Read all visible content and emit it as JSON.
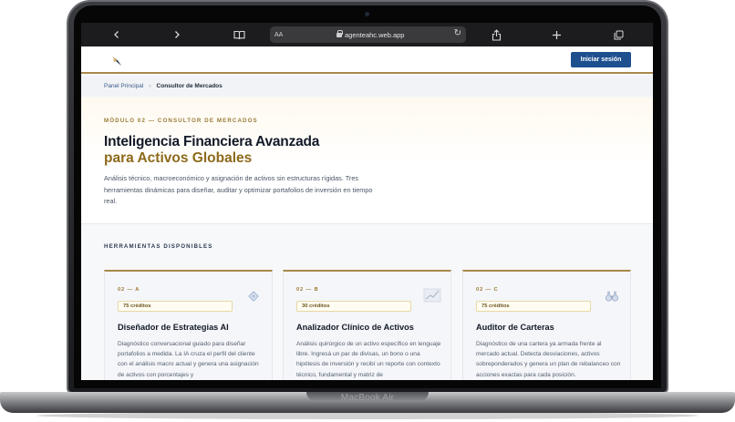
{
  "device": {
    "model_label": "MacBook Air"
  },
  "browser": {
    "address_text_size": "AA",
    "url": "agenteahc.web.app",
    "icons": [
      "back-icon",
      "forward-icon",
      "bookmarks-icon",
      "reload-icon",
      "share-icon",
      "new-tab-icon",
      "tabs-icon"
    ]
  },
  "header": {
    "login_label": "Iniciar sesión",
    "brand_color": "#1e4f8f",
    "accent_color": "#a8894a"
  },
  "breadcrumb": {
    "home": "Panel Principal",
    "separator": "›",
    "current": "Consultor de Mercados"
  },
  "hero": {
    "eyebrow": "MÓDULO 02 — CONSULTOR DE MERCADOS",
    "title": "Inteligencia Financiera Avanzada",
    "title_accent": "para Activos Globales",
    "description": "Análisis técnico, macroeconómico y asignación de activos sin estructuras rígidas. Tres herramientas dinámicas para diseñar, auditar y optimizar portafolios de inversión en tiempo real."
  },
  "tools": {
    "section_label": "HERRAMIENTAS DISPONIBLES",
    "cards": [
      {
        "code": "02 — A",
        "credits": "75 créditos",
        "icon": "diamond-icon",
        "title": "Diseñador de Estrategias AI",
        "description": "Diagnóstico conversacional guiado para diseñar portafolios a medida. La IA cruza el perfil del cliente con el análisis macro actual y genera una asignación de activos con porcentajes y"
      },
      {
        "code": "02 — B",
        "credits": "30 créditos",
        "icon": "chart-icon",
        "title": "Analizador Clínico de Activos",
        "description": "Análisis quirúrgico de un activo específico en lenguaje libre. Ingresá un par de divisas, un bono o una hipótesis de inversión y recibí un reporte con contexto técnico, fundamental y matriz de"
      },
      {
        "code": "02 — C",
        "credits": "75 créditos",
        "icon": "binoculars-icon",
        "title": "Auditor de Carteras",
        "description": "Diagnóstico de una cartera ya armada frente al mercado actual. Detecta desviaciones, activos sobreponderados y genera un plan de rebalanceo con acciones exactas para cada posición."
      }
    ]
  }
}
